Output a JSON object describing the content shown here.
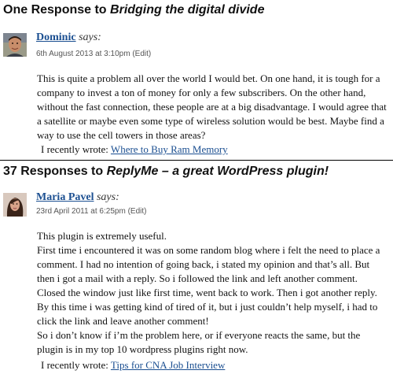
{
  "comment_section_1": {
    "heading_prefix": "One Response to ",
    "heading_post_title": "Bridging the digital divide",
    "comment": {
      "author": "Dominic",
      "says": "says:",
      "date": "6th August 2013 at 3:10pm",
      "edit": "(Edit)",
      "body": "This is quite a problem all over the world I would bet. On one hand, it is tough for a company to invest a ton of money for only a few subscribers. On the other hand, without the fast connection, these people are at a big disadvantage. I would agree that a satellite or maybe even some type of wireless solution would be best. Maybe find a way to use the cell towers in those areas?",
      "recent_prefix": "I recently wrote: ",
      "recent_link": "Where to Buy Ram Memory"
    }
  },
  "comment_section_2": {
    "heading_prefix": "37 Responses to ",
    "heading_post_title": "ReplyMe – a great WordPress plugin!",
    "comment": {
      "author": "Maria Pavel",
      "says": "says:",
      "date": "23rd April 2011 at 6:25pm",
      "edit": "(Edit)",
      "body_lines": [
        "This plugin is extremely useful.",
        "First time i encountered it was on some random blog where i felt the need to place a comment. I had no intention of going back, i stated my opinion and that’s all. But then i got a mail with a reply. So i followed the link and left another comment. Closed the window just like first time, went back to work. Then i got another reply. By this time i was getting kind of tired of it, but i just couldn’t help myself, i had to click the link and leave another comment!",
        "So i don’t know if i’m the problem here, or if everyone reacts the same, but the plugin is in my top 10 wordpress plugins right now."
      ],
      "recent_prefix": "I recently wrote: ",
      "recent_link": "Tips for CNA Job Interview"
    }
  },
  "colors": {
    "link": "#1b4f91",
    "text": "#111111",
    "meta": "#555555",
    "divider": "#000000"
  }
}
